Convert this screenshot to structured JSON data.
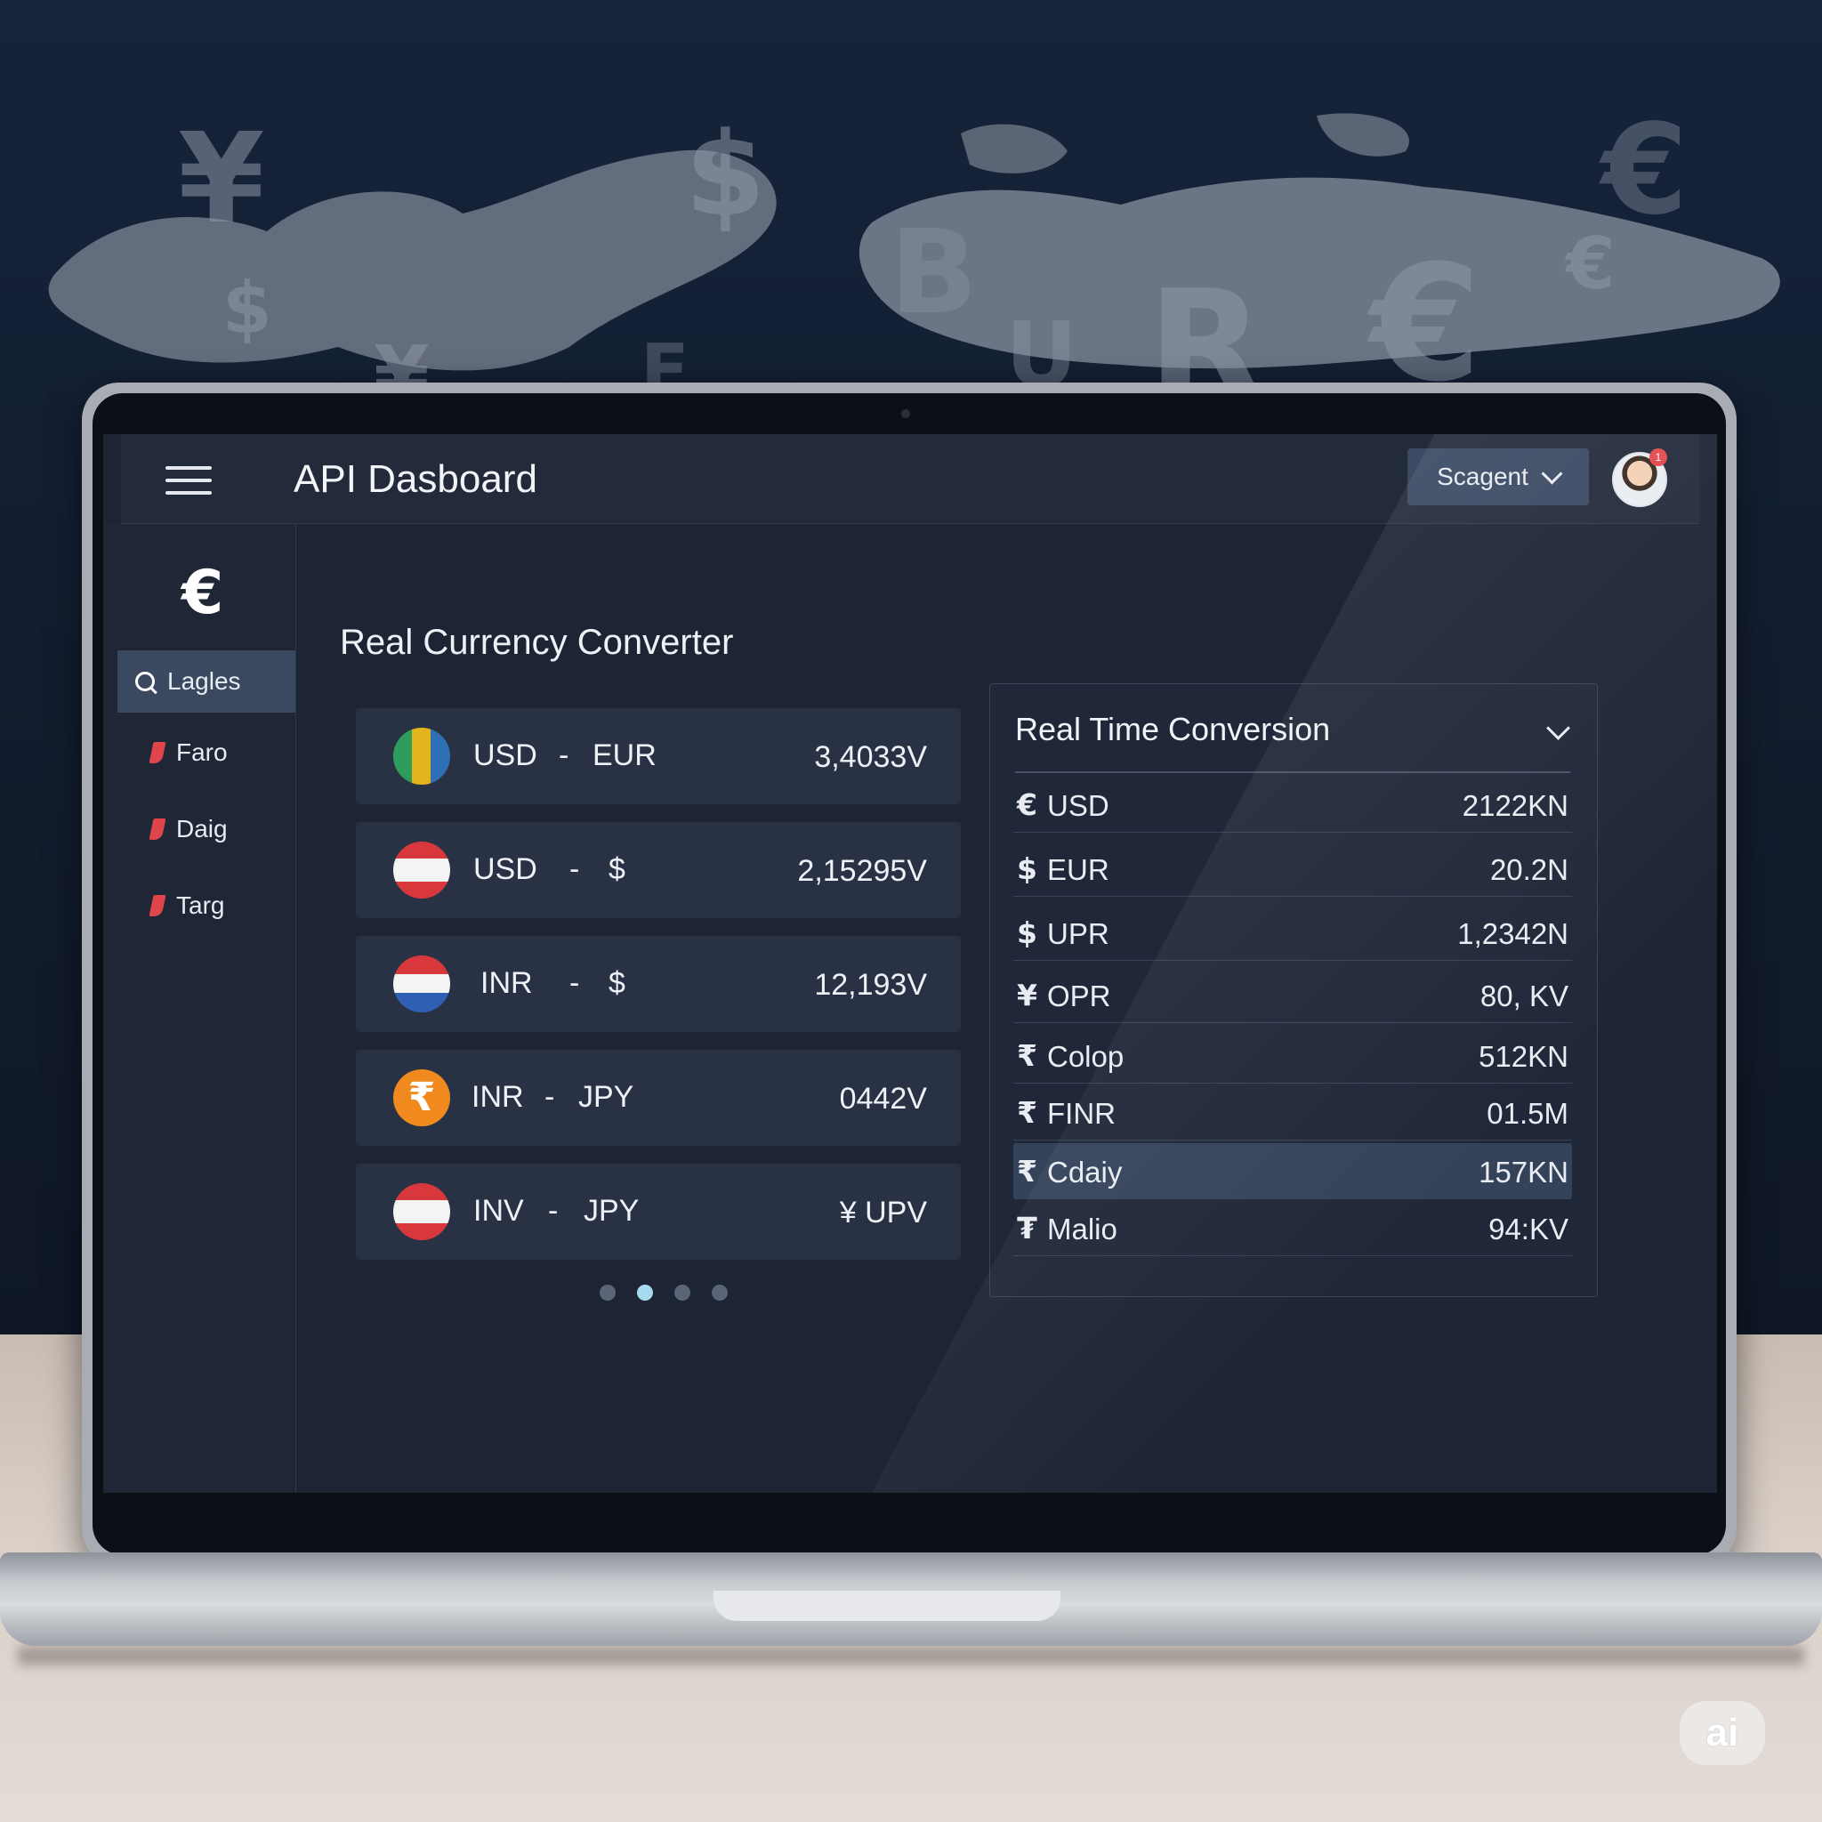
{
  "background": {
    "glyphs": [
      "¥",
      "$",
      "€",
      "$",
      "¥",
      "B",
      "R",
      "€",
      "€",
      "U",
      "F"
    ]
  },
  "header": {
    "title": "API Dasboard",
    "env_select": "Scagent",
    "notification_count": "1"
  },
  "sidebar": {
    "logo_glyph": "€",
    "items": [
      {
        "label": "Lagles",
        "icon": "search-icon"
      },
      {
        "label": "Faro",
        "icon": "bookmark-icon"
      },
      {
        "label": "Daig",
        "icon": "bookmark-icon"
      },
      {
        "label": "Targ",
        "icon": "bookmark-icon"
      }
    ]
  },
  "converter": {
    "title": "Real Currency Converter",
    "pairs": [
      {
        "from": "USD",
        "sep": "-",
        "to": "EUR",
        "rate": "3,4033V",
        "flag": "green-yellow-blue"
      },
      {
        "from": "USD",
        "sep": "-",
        "to": "$",
        "rate": "2,15295V",
        "flag": "red-white-red"
      },
      {
        "from": "INR",
        "sep": "-",
        "to": "$",
        "rate": "12,193V",
        "flag": "red-white-blue"
      },
      {
        "from": "INR",
        "sep": "-",
        "to": "JPY",
        "rate": "0442V",
        "flag": "rupee-orange"
      },
      {
        "from": "INV",
        "sep": "-",
        "to": "JPY",
        "rate": "¥ UPV",
        "flag": "red-white-red"
      }
    ],
    "pagination": {
      "pages": 4,
      "active": 2
    }
  },
  "realtime": {
    "title": "Real Time Conversion",
    "rows": [
      {
        "symbol": "€",
        "name": "USD",
        "value": "2122KN"
      },
      {
        "symbol": "$",
        "name": "EUR",
        "value": "20.2N"
      },
      {
        "symbol": "$",
        "name": "UPR",
        "value": "1,2342N"
      },
      {
        "symbol": "¥",
        "name": "OPR",
        "value": "80, KV"
      },
      {
        "symbol": "₹",
        "name": "Colop",
        "value": "512KN"
      },
      {
        "symbol": "₹",
        "name": "FINR",
        "value": "01.5M"
      },
      {
        "symbol": "₹",
        "name": "Cdaiy",
        "value": "157KN",
        "highlighted": true
      },
      {
        "symbol": "₮",
        "name": "Malio",
        "value": "94:KV"
      }
    ]
  },
  "watermark": "ai",
  "colors": {
    "screen_bg": "#1d2535",
    "card_bg": "#283244",
    "accent_dot": "#a7d9f0",
    "sidebar_active": "#3a4860",
    "bookmark_red": "#e0454b"
  }
}
